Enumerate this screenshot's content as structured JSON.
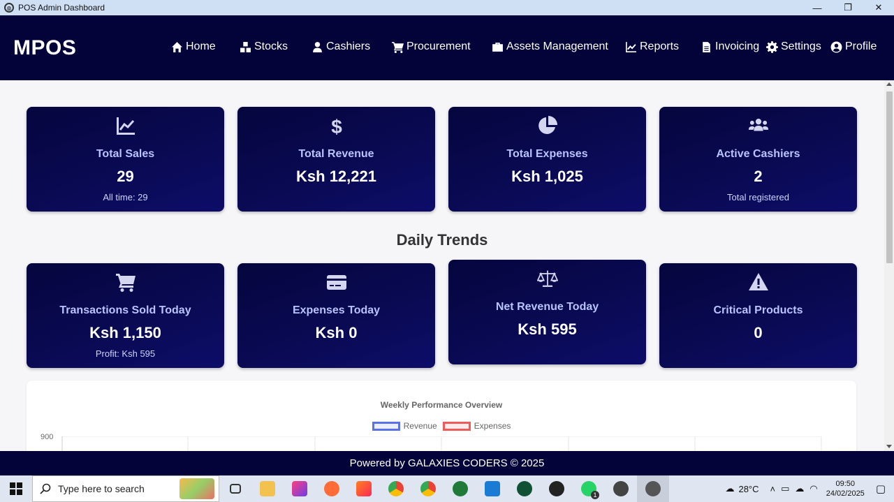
{
  "window": {
    "title": "POS Admin Dashboard",
    "minimize": "—",
    "maximize": "❐",
    "close": "✕"
  },
  "nav": {
    "brand": "MPOS",
    "items": [
      {
        "label": "Home",
        "icon": "home-icon"
      },
      {
        "label": "Stocks",
        "icon": "cubes-icon"
      },
      {
        "label": "Cashiers",
        "icon": "user-icon"
      },
      {
        "label": "Procurement",
        "icon": "cart-icon"
      },
      {
        "label": "Assets Management",
        "icon": "briefcase-icon"
      },
      {
        "label": "Reports",
        "icon": "chart-line-icon"
      },
      {
        "label": "Invoicing",
        "icon": "file-icon"
      },
      {
        "label": "Settings",
        "icon": "gear-icon"
      },
      {
        "label": "Profile",
        "icon": "user-circle-icon"
      }
    ]
  },
  "summary_cards": [
    {
      "label": "Total Sales",
      "value": "29",
      "sub": "All time: 29",
      "icon": "chart-line-icon"
    },
    {
      "label": "Total Revenue",
      "value": "Ksh 12,221",
      "sub": "",
      "icon": "dollar-icon"
    },
    {
      "label": "Total Expenses",
      "value": "Ksh 1,025",
      "sub": "",
      "icon": "pie-chart-icon"
    },
    {
      "label": "Active Cashiers",
      "value": "2",
      "sub": "Total registered",
      "icon": "users-icon"
    }
  ],
  "daily_title": "Daily Trends",
  "daily_cards": [
    {
      "label": "Transactions Sold Today",
      "value": "Ksh 1,150",
      "sub": "Profit: Ksh 595",
      "icon": "cart-icon"
    },
    {
      "label": "Expenses Today",
      "value": "Ksh 0",
      "sub": "",
      "icon": "credit-card-icon"
    },
    {
      "label": "Net Revenue Today",
      "value": "Ksh 595",
      "sub": "",
      "icon": "balance-scale-icon"
    },
    {
      "label": "Critical Products",
      "value": "0",
      "sub": "",
      "icon": "warning-icon"
    }
  ],
  "chart": {
    "title": "Weekly Performance Overview",
    "legend": [
      {
        "label": "Revenue",
        "color": "#5b72e6"
      },
      {
        "label": "Expenses",
        "color": "#ef5b5b"
      }
    ],
    "y_top_tick": "900"
  },
  "footer": {
    "text": "Powered by GALAXIES CODERS © 2025"
  },
  "taskbar": {
    "search_placeholder": "Type here to search",
    "temperature": "28°C",
    "time": "09:50",
    "date": "24/02/2025",
    "whatsapp_badge": "1"
  },
  "colors": {
    "navbar": "#03033a",
    "card_label": "#b9c3ff",
    "accent": "#0d0d6a"
  }
}
